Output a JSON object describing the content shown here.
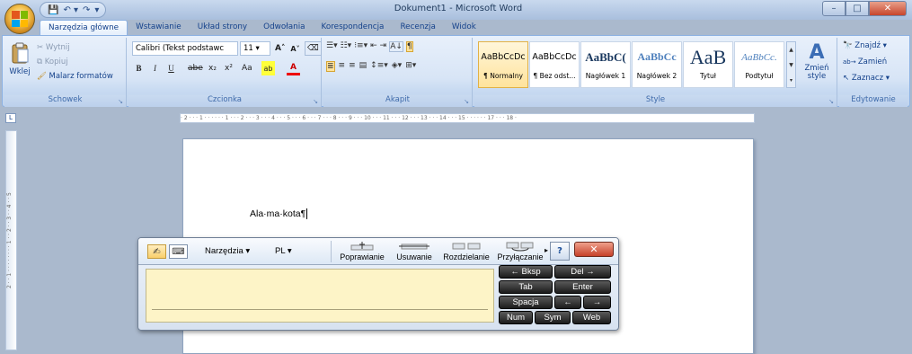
{
  "window": {
    "title": "Dokument1 - Microsoft Word",
    "quick_access": [
      "💾",
      "↶ ▾",
      "↷",
      "▾"
    ],
    "controls": {
      "minimize": "–",
      "maximize": "□",
      "close": "✕"
    }
  },
  "tabs": [
    {
      "label": "Narzędzia główne"
    },
    {
      "label": "Wstawianie"
    },
    {
      "label": "Układ strony"
    },
    {
      "label": "Odwołania"
    },
    {
      "label": "Korespondencja"
    },
    {
      "label": "Recenzja"
    },
    {
      "label": "Widok"
    }
  ],
  "ribbon": {
    "clipboard": {
      "caption": "Schowek",
      "paste": "Wklej",
      "cut": "Wytnij",
      "copy": "Kopiuj",
      "format_painter": "Malarz formatów"
    },
    "font": {
      "caption": "Czcionka",
      "font_name": "Calibri (Tekst podstawc",
      "font_size": "11",
      "grow": "A˄",
      "shrink": "A˅",
      "bold": "B",
      "italic": "I",
      "underline": "U",
      "strike": "abe",
      "subscript": "x₂",
      "superscript": "x²",
      "change_case": "Aa",
      "highlight": "ab",
      "font_color": "A"
    },
    "paragraph": {
      "caption": "Akapit"
    },
    "styles": {
      "caption": "Style",
      "items": [
        {
          "sample": "AaBbCcDc",
          "name": "¶ Normalny"
        },
        {
          "sample": "AaBbCcDc",
          "name": "¶ Bez odst..."
        },
        {
          "sample": "AaBbC(",
          "name": "Nagłówek 1"
        },
        {
          "sample": "AaBbCc",
          "name": "Nagłówek 2"
        },
        {
          "sample": "AaB",
          "name": "Tytuł"
        },
        {
          "sample": "AaBbCc.",
          "name": "Podtytuł"
        }
      ],
      "change_styles": "Zmień style"
    },
    "editing": {
      "caption": "Edytowanie",
      "find": "Znajdź",
      "replace": "Zamień",
      "select": "Zaznacz"
    }
  },
  "ruler": {
    "tab_selector": "L",
    "h_text": "· 2 · · · 1 · · · · · · 1 · · · 2 · · · 3 · · · 4 · · · 5 · · · 6 · · · 7 · · · 8 · · · 9 · · · 10 · · · 11 · · · 12 · · · 13 · · · 14 · · · 15 · · · · · · 17 · · · 18 ·",
    "v_text": "2 · · 1 · · · · · · · · 1 · · 2 · · 3 · · 4 · · 5"
  },
  "document": {
    "text": "Ala·ma·kota¶"
  },
  "input_panel": {
    "menu_tools": "Narzędzia",
    "menu_lang": "PL",
    "gestures": [
      "Poprawianie",
      "Usuwanie",
      "Rozdzielanie",
      "Przyłączanie"
    ],
    "help": "?",
    "close": "✕",
    "keys": {
      "bksp": "←   Bksp",
      "del": "Del   →",
      "tab": "Tab",
      "enter": "Enter",
      "space": "Spacja",
      "left": "←",
      "right": "→",
      "num": "Num",
      "sym": "Sym",
      "web": "Web"
    }
  },
  "colors": {
    "accent": "#15428b",
    "ribbon_bg": "#d8e5f6",
    "writing_area": "#fdf4c7",
    "close_red": "#c6412a"
  }
}
